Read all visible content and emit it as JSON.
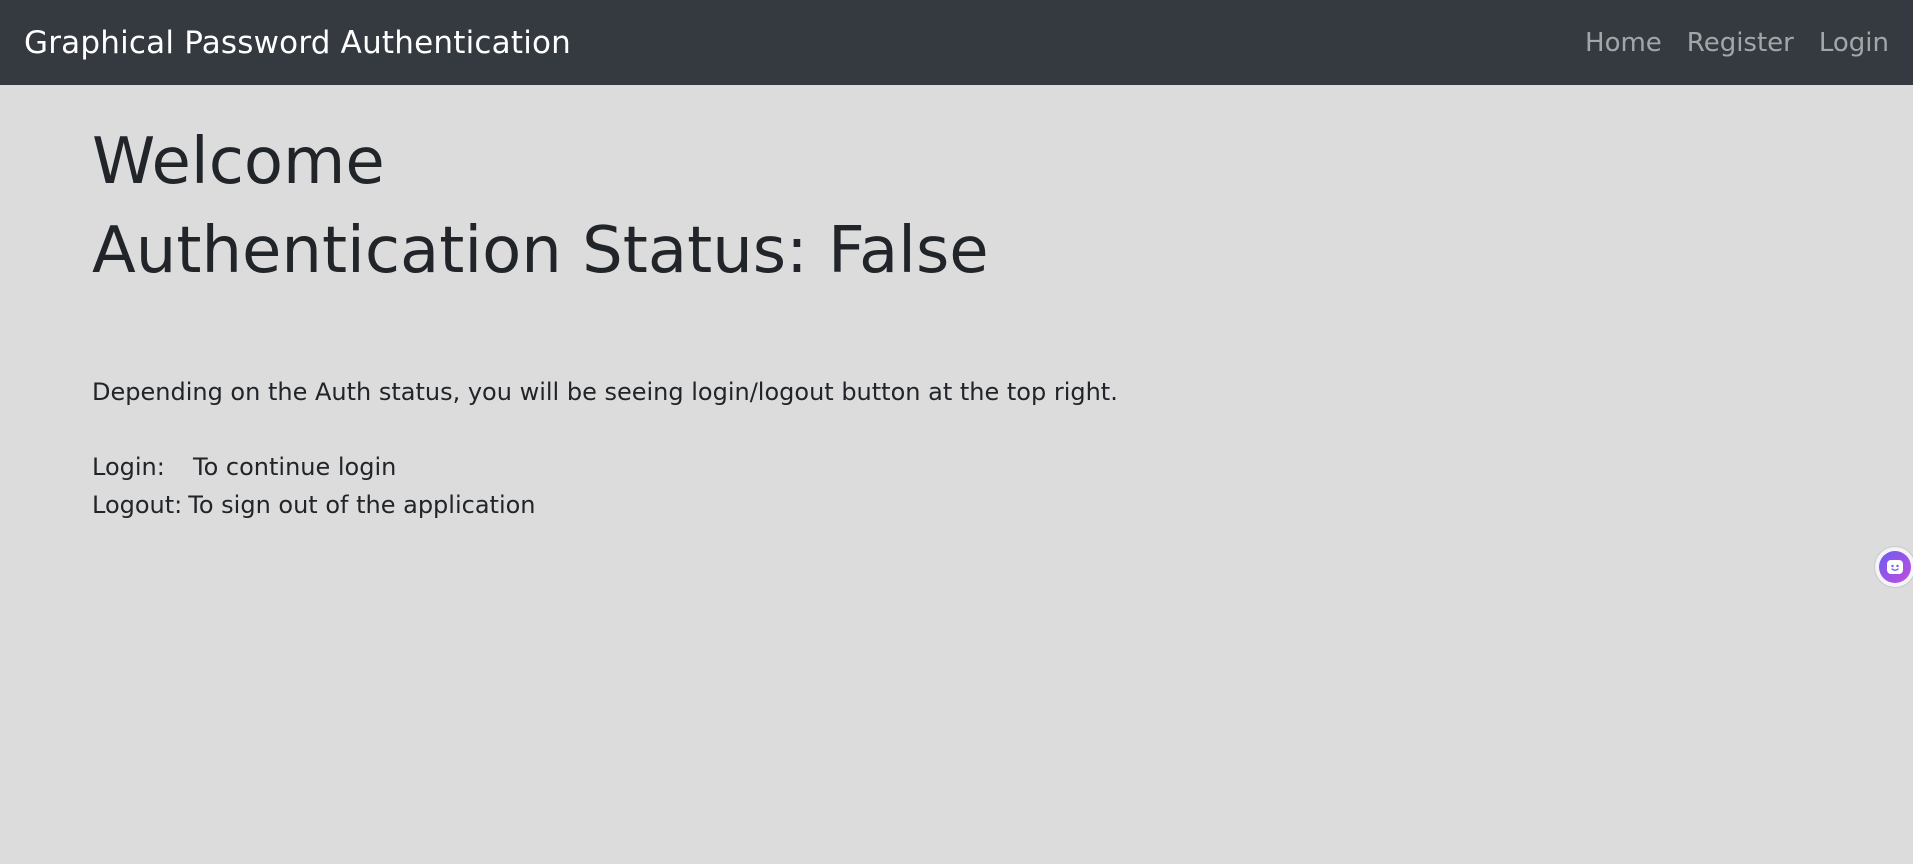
{
  "navbar": {
    "brand": "Graphical Password Authentication",
    "links": [
      {
        "label": "Home"
      },
      {
        "label": "Register"
      },
      {
        "label": "Login"
      }
    ],
    "background_color": "#343a40"
  },
  "main": {
    "heading_line1": "Welcome",
    "heading_line2": "Authentication Status: False",
    "description": "Depending on the Auth status, you will be seeing login/logout button at the top right.",
    "legend": [
      {
        "key": "Login:",
        "value": "To continue login"
      },
      {
        "key": "Logout:",
        "value": "To sign out of the application"
      }
    ],
    "background_color": "#dcdcdc"
  },
  "widgets": {
    "chat_icon": "smiley-chat-icon",
    "chat_color": "#7b5cf0"
  }
}
